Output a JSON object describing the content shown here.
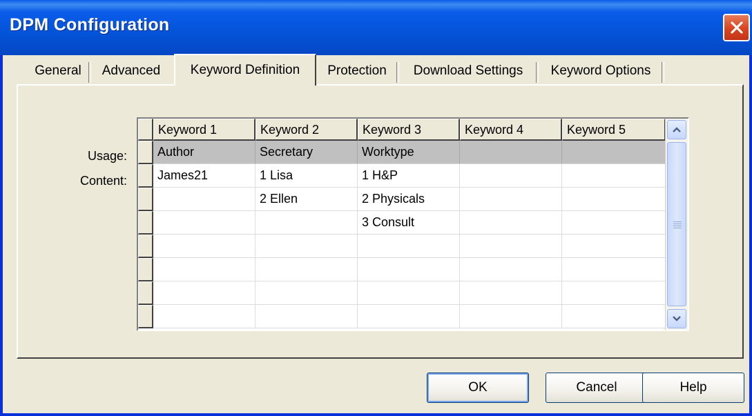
{
  "window": {
    "title": "DPM Configuration"
  },
  "tabs": [
    {
      "label": "General",
      "active": false
    },
    {
      "label": "Advanced",
      "active": false
    },
    {
      "label": "Keyword Definition",
      "active": true
    },
    {
      "label": "Protection",
      "active": false
    },
    {
      "label": "Download Settings",
      "active": false
    },
    {
      "label": "Keyword Options",
      "active": false
    }
  ],
  "grid": {
    "columns": [
      "Keyword 1",
      "Keyword 2",
      "Keyword 3",
      "Keyword 4",
      "Keyword 5"
    ],
    "row_labels": {
      "usage": "Usage:",
      "content": "Content:"
    },
    "usage": [
      "Author",
      "Secretary",
      "Worktype",
      "",
      ""
    ],
    "content_rows": [
      [
        "James21",
        "1 Lisa",
        "1 H&P",
        "",
        ""
      ],
      [
        "",
        "2 Ellen",
        "2 Physicals",
        "",
        ""
      ],
      [
        "",
        "",
        "3 Consult",
        "",
        ""
      ],
      [
        "",
        "",
        "",
        "",
        ""
      ],
      [
        "",
        "",
        "",
        "",
        ""
      ],
      [
        "",
        "",
        "",
        "",
        ""
      ],
      [
        "",
        "",
        "",
        "",
        ""
      ]
    ]
  },
  "buttons": {
    "ok": "OK",
    "cancel": "Cancel",
    "help": "Help"
  },
  "colors": {
    "title_bar": "#0a5ce9",
    "close_button": "#d9441f",
    "dialog_bg": "#ece9d8",
    "usage_row_bg": "#c0c0c0"
  },
  "icons": {
    "close": "close-icon",
    "scroll_up": "chevron-up-icon",
    "scroll_down": "chevron-down-icon"
  }
}
